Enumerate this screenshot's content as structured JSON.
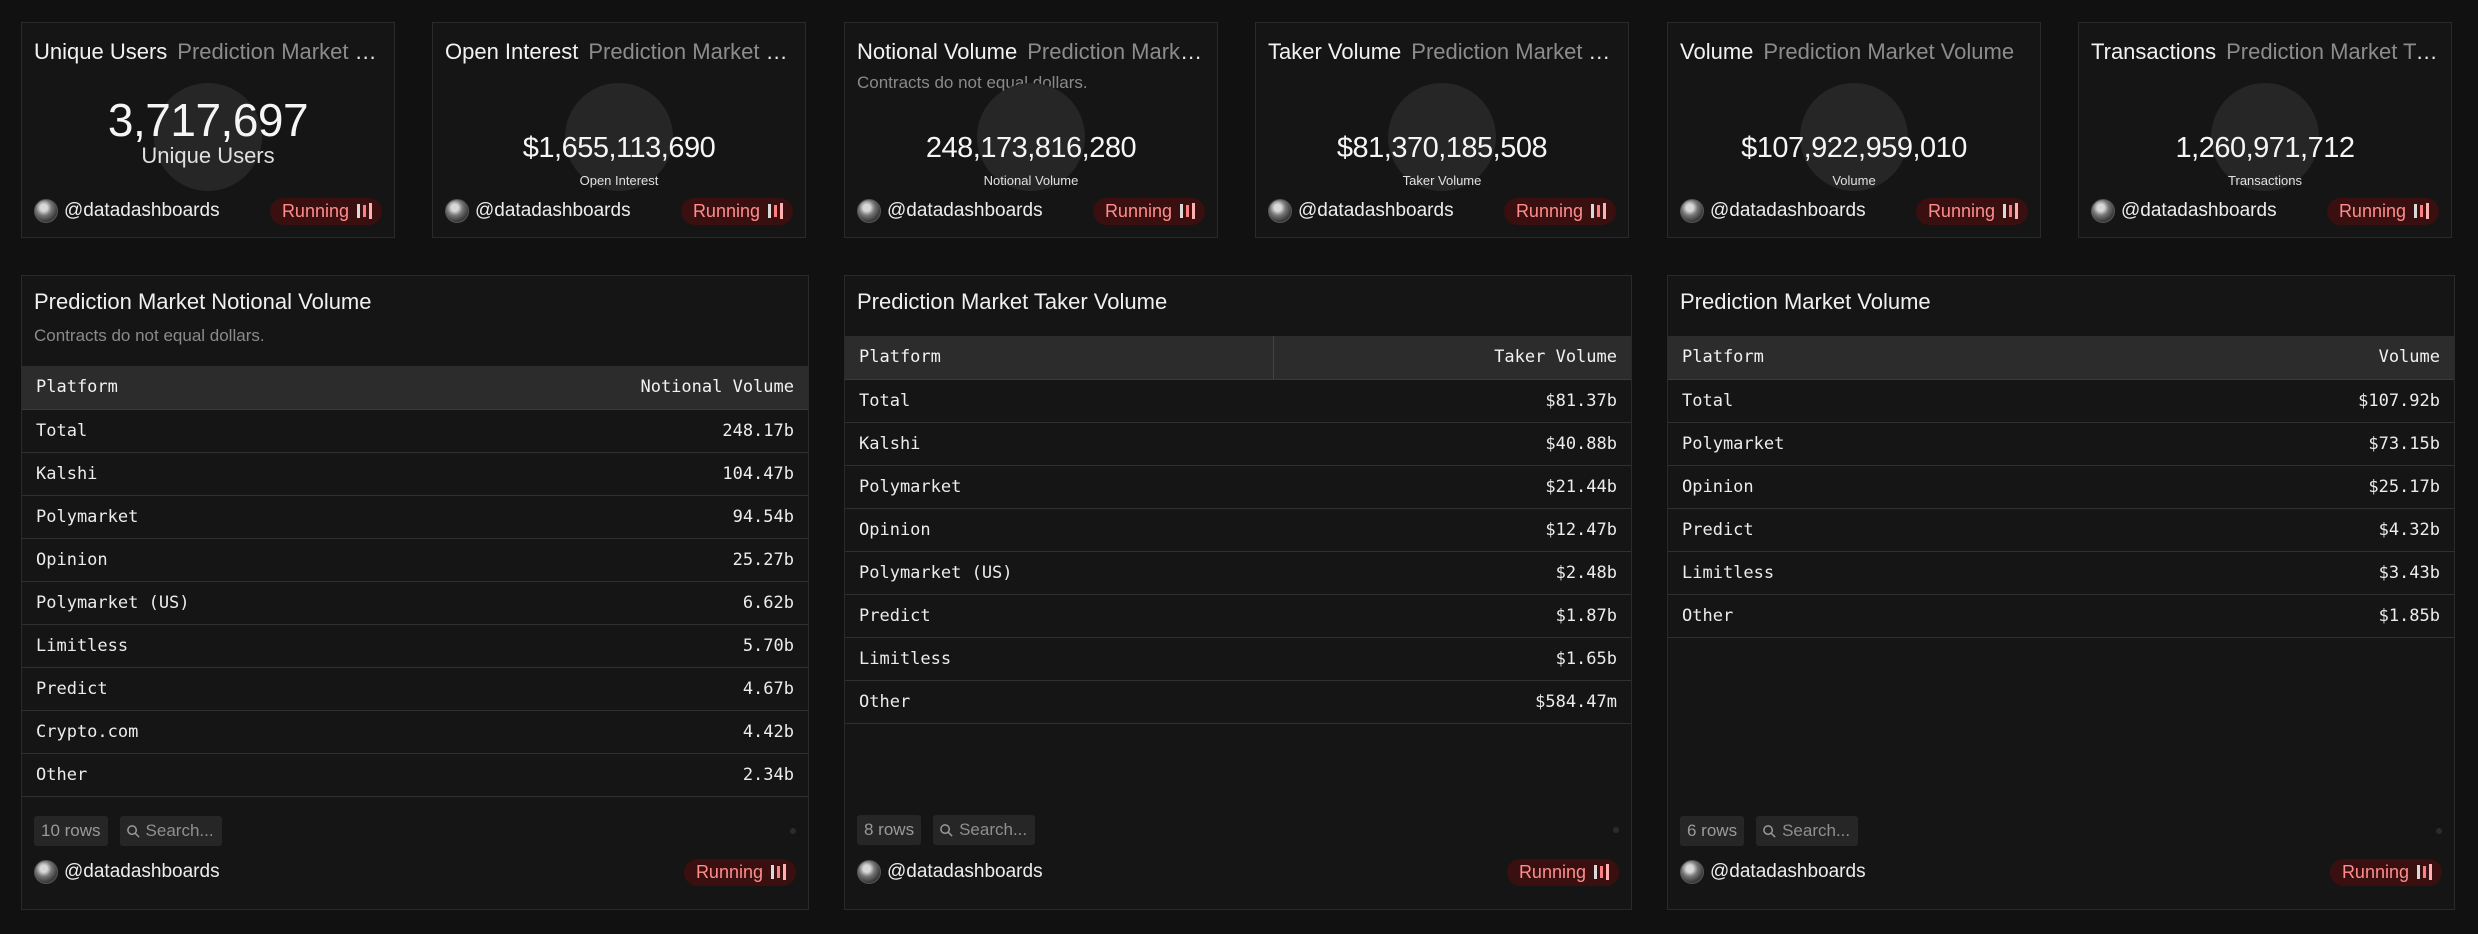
{
  "counters": [
    {
      "title": "Unique Users",
      "subtitle": "Prediction Market Unique Users",
      "value": "3,717,697",
      "label": "Unique Users",
      "author": "@datadashboards",
      "status": "Running"
    },
    {
      "title": "Open Interest",
      "subtitle": "Prediction Market Open Interest",
      "value": "$1,655,113,690",
      "label": "Open Interest",
      "author": "@datadashboards",
      "status": "Running"
    },
    {
      "title": "Notional Volume",
      "subtitle": "Prediction Market Notional Volume",
      "description": "Contracts do not equal dollars.",
      "value": "248,173,816,280",
      "label": "Notional Volume",
      "author": "@datadashboards",
      "status": "Running"
    },
    {
      "title": "Taker Volume",
      "subtitle": "Prediction Market Taker Volume",
      "value": "$81,370,185,508",
      "label": "Taker Volume",
      "author": "@datadashboards",
      "status": "Running"
    },
    {
      "title": "Volume",
      "subtitle": "Prediction Market Volume",
      "value": "$107,922,959,010",
      "label": "Volume",
      "author": "@datadashboards",
      "status": "Running"
    },
    {
      "title": "Transactions",
      "subtitle": "Prediction Market Transactions",
      "value": "1,260,971,712",
      "label": "Transactions",
      "author": "@datadashboards",
      "status": "Running"
    }
  ],
  "tables": [
    {
      "title": "Prediction Market Notional Volume",
      "description": "Contracts do not equal dollars.",
      "columns": [
        "Platform",
        "Notional Volume"
      ],
      "rows": [
        [
          "Total",
          "248.17b"
        ],
        [
          "Kalshi",
          "104.47b"
        ],
        [
          "Polymarket",
          "94.54b"
        ],
        [
          "Opinion",
          "25.27b"
        ],
        [
          "Polymarket (US)",
          "6.62b"
        ],
        [
          "Limitless",
          "5.70b"
        ],
        [
          "Predict",
          "4.67b"
        ],
        [
          "Crypto.com",
          "4.42b"
        ],
        [
          "Other",
          "2.34b"
        ]
      ],
      "row_count": "10 rows",
      "search_placeholder": "Search...",
      "author": "@datadashboards",
      "status": "Running"
    },
    {
      "title": "Prediction Market Taker Volume",
      "columns": [
        "Platform",
        "Taker Volume"
      ],
      "rows": [
        [
          "Total",
          "$81.37b"
        ],
        [
          "Kalshi",
          "$40.88b"
        ],
        [
          "Polymarket",
          "$21.44b"
        ],
        [
          "Opinion",
          "$12.47b"
        ],
        [
          "Polymarket (US)",
          "$2.48b"
        ],
        [
          "Predict",
          "$1.87b"
        ],
        [
          "Limitless",
          "$1.65b"
        ],
        [
          "Other",
          "$584.47m"
        ]
      ],
      "row_count": "8 rows",
      "search_placeholder": "Search...",
      "author": "@datadashboards",
      "status": "Running"
    },
    {
      "title": "Prediction Market Volume",
      "columns": [
        "Platform",
        "Volume"
      ],
      "rows": [
        [
          "Total",
          "$107.92b"
        ],
        [
          "Polymarket",
          "$73.15b"
        ],
        [
          "Opinion",
          "$25.17b"
        ],
        [
          "Predict",
          "$4.32b"
        ],
        [
          "Limitless",
          "$3.43b"
        ],
        [
          "Other",
          "$1.85b"
        ]
      ],
      "row_count": "6 rows",
      "search_placeholder": "Search...",
      "author": "@datadashboards",
      "status": "Running"
    }
  ]
}
